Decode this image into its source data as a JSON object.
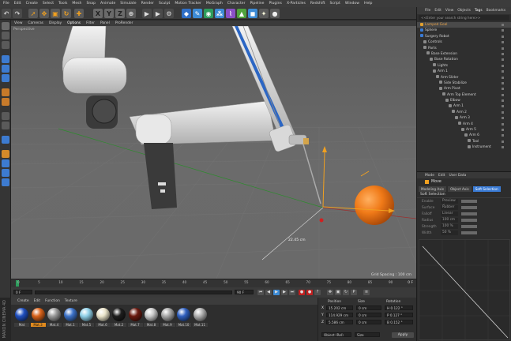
{
  "menubar": [
    "File",
    "Edit",
    "Create",
    "Select",
    "Tools",
    "Mesh",
    "Snap",
    "Animate",
    "Simulate",
    "Render",
    "Sculpt",
    "Motion Tracker",
    "MoGraph",
    "Character",
    "Pipeline",
    "Plugins",
    "X-Particles",
    "Redshift",
    "Script",
    "Window",
    "Help"
  ],
  "viewport": {
    "menu": [
      "View",
      "Cameras",
      "Display",
      "Options",
      "Filter",
      "Panel",
      "ProRender"
    ],
    "camera_label": "Perspective",
    "grid_spacing": "Grid Spacing : 100 cm"
  },
  "timeline": {
    "ticks": [
      "0",
      "5",
      "10",
      "15",
      "20",
      "25",
      "30",
      "35",
      "40",
      "45",
      "50",
      "55",
      "60",
      "65",
      "70",
      "75",
      "80",
      "85",
      "90"
    ],
    "end_label": "0 F",
    "start_field": "0 F",
    "end_field": "90 F"
  },
  "materials": {
    "menu": [
      "Create",
      "Edit",
      "Function",
      "Texture"
    ],
    "items": [
      {
        "name": "Mat",
        "color": "#1f4fbf"
      },
      {
        "name": "Mat.3",
        "color": "#d9621a"
      },
      {
        "name": "Mat.4",
        "color": "#9a9a9a"
      },
      {
        "name": "Mat.1",
        "color": "#3d73c9"
      },
      {
        "name": "Mat.5",
        "color": "#8fd0e8"
      },
      {
        "name": "Mat.6",
        "color": "#e9e3c9"
      },
      {
        "name": "Mat.2",
        "color": "#1e1e1e"
      },
      {
        "name": "Mat.7",
        "color": "#6a1a10"
      },
      {
        "name": "Mat.8",
        "color": "#c9c9c9"
      },
      {
        "name": "Mat.9",
        "color": "#a8a8a8"
      },
      {
        "name": "Mat.10",
        "color": "#3060c0"
      },
      {
        "name": "Mat.11",
        "color": "#b0b0b0"
      }
    ]
  },
  "coordinates": {
    "headers": [
      "Position",
      "Size",
      "Rotation"
    ],
    "rows": [
      {
        "axis": "X",
        "pos": "15.202 cm",
        "size": "0 cm",
        "rot": "H 0.122 °"
      },
      {
        "axis": "Y",
        "pos": "114.929 cm",
        "size": "0 cm",
        "rot": "P 0.127 °"
      },
      {
        "axis": "Z",
        "pos": "5.586 cm",
        "size": "0 cm",
        "rot": "B 0.152 °"
      }
    ],
    "mode": "Object (Rel)",
    "size_mode": "Size",
    "apply_label": "Apply"
  },
  "objects": {
    "tabs": [
      "File",
      "Edit",
      "View",
      "Objects",
      "Tags",
      "Bookmarks"
    ],
    "search_placeholder": "<<Enter your search string here>>",
    "tree": [
      {
        "label": "Lamped Goal",
        "depth": 0,
        "color": "#e0a030",
        "selected": true,
        "highlight": "#e8a34a"
      },
      {
        "label": "Sphere",
        "depth": 0,
        "color": "#3a7bd5"
      },
      {
        "label": "Surgery Robot",
        "depth": 0,
        "color": "#3a7bd5"
      },
      {
        "label": "Controls",
        "depth": 1,
        "color": "#8a8a8a"
      },
      {
        "label": "Parts",
        "depth": 1,
        "color": "#8a8a8a"
      },
      {
        "label": "Base Extension",
        "depth": 2,
        "color": "#8a8a8a"
      },
      {
        "label": "Base Rotation",
        "depth": 3,
        "color": "#8a8a8a"
      },
      {
        "label": "Lights",
        "depth": 4,
        "color": "#8a8a8a"
      },
      {
        "label": "Arm 1",
        "depth": 4,
        "color": "#8a8a8a"
      },
      {
        "label": "Arm Slider",
        "depth": 5,
        "color": "#8a8a8a"
      },
      {
        "label": "Side Stabilize",
        "depth": 6,
        "color": "#8a8a8a"
      },
      {
        "label": "Arm Pivot",
        "depth": 6,
        "color": "#8a8a8a"
      },
      {
        "label": "Arm Top Element",
        "depth": 7,
        "color": "#8a8a8a"
      },
      {
        "label": "Elbow",
        "depth": 8,
        "color": "#8a8a8a"
      },
      {
        "label": "Arm 1",
        "depth": 9,
        "color": "#8a8a8a"
      },
      {
        "label": "Arm 2",
        "depth": 10,
        "color": "#8a8a8a"
      },
      {
        "label": "Arm 3",
        "depth": 11,
        "color": "#8a8a8a"
      },
      {
        "label": "Arm 4",
        "depth": 12,
        "color": "#8a8a8a"
      },
      {
        "label": "Arm 5",
        "depth": 13,
        "color": "#8a8a8a"
      },
      {
        "label": "Arm 6",
        "depth": 14,
        "color": "#8a8a8a"
      },
      {
        "label": "Tool",
        "depth": 15,
        "color": "#8a8a8a"
      },
      {
        "label": "Instrument",
        "depth": 15,
        "color": "#8a8a8a"
      }
    ]
  },
  "attributes": {
    "tabs": [
      "Mode",
      "Edit",
      "User Data"
    ],
    "title": "Move",
    "subtabs": [
      "Modeling Axis",
      "Object Axis",
      "Soft Selection"
    ],
    "active_subtab": "Soft Selection",
    "section": "Soft Selection",
    "params": [
      {
        "label": "Enable",
        "value": "Preview ✓"
      },
      {
        "label": "Surface",
        "value": "Rubber"
      },
      {
        "label": "Falloff",
        "value": "Linear"
      },
      {
        "label": "Radius",
        "value": "100 cm"
      },
      {
        "label": "Strength",
        "value": "100 %"
      },
      {
        "label": "Width",
        "value": "50 %"
      }
    ]
  },
  "side_label": "MAXON CINEMA 4D"
}
